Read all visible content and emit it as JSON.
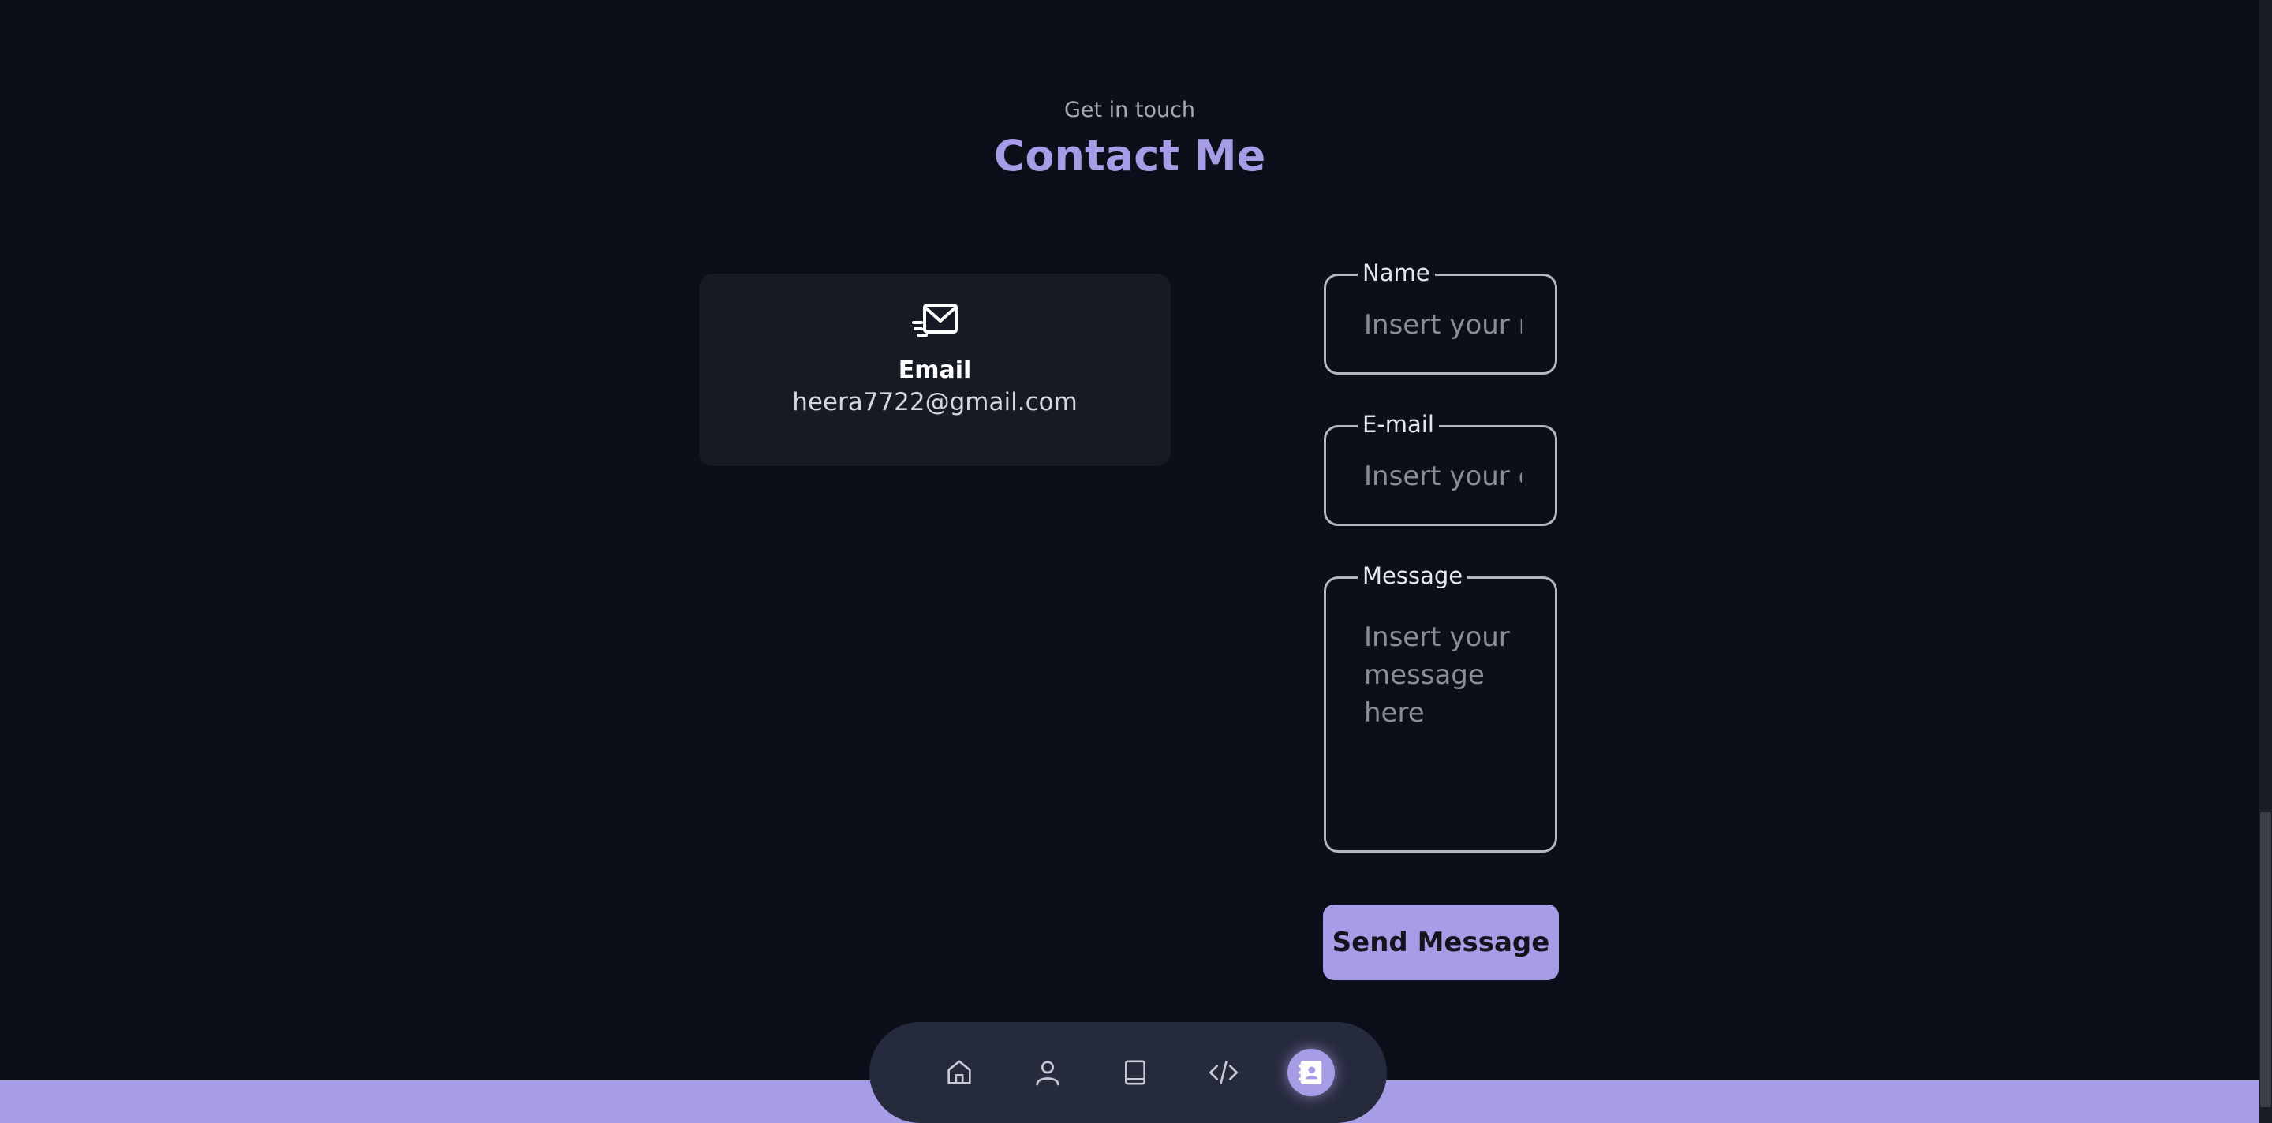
{
  "header": {
    "subtitle": "Get in touch",
    "title": "Contact Me"
  },
  "contact_card": {
    "icon": "mail-icon",
    "label": "Email",
    "value": "heera7722@gmail.com"
  },
  "form": {
    "name": {
      "legend": "Name",
      "placeholder": "Insert your name"
    },
    "email": {
      "legend": "E-mail",
      "placeholder": "Insert your email"
    },
    "message": {
      "legend": "Message",
      "placeholder": "Insert your message here"
    },
    "submit_label": "Send Message"
  },
  "nav": {
    "items": [
      {
        "icon": "home-icon",
        "active": false
      },
      {
        "icon": "user-icon",
        "active": false
      },
      {
        "icon": "book-icon",
        "active": false
      },
      {
        "icon": "code-icon",
        "active": false
      },
      {
        "icon": "contact-icon",
        "active": true
      }
    ]
  },
  "colors": {
    "background": "#0b0f1a",
    "accent": "#a79de6",
    "card": "#161a25",
    "nav": "#262a3d"
  }
}
